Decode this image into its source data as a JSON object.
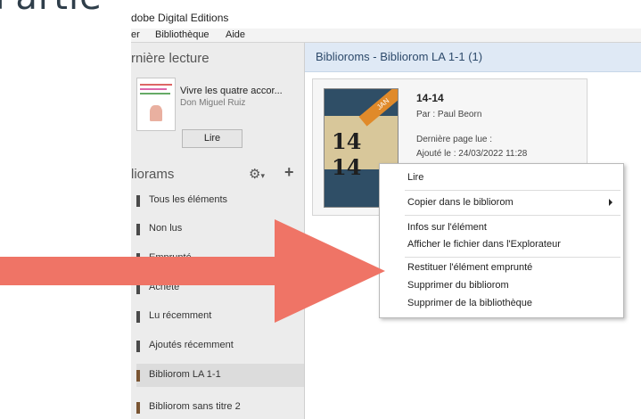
{
  "top_cut_text": "Partie",
  "app": {
    "title": "dobe Digital Editions"
  },
  "menu": {
    "items": [
      "er",
      "Bibliothèque",
      "Aide"
    ]
  },
  "recent": {
    "heading": "rnière lecture",
    "book_title": "Vivre les quatre accor...",
    "book_author": "Don Miguel Ruiz",
    "read_label": "Lire"
  },
  "bookshelves": {
    "heading": "liorams",
    "items": [
      {
        "label": "Tous les éléments"
      },
      {
        "label": "Non lus"
      },
      {
        "label": "Emprunté"
      },
      {
        "label": "Acheté"
      },
      {
        "label": "Lu récemment"
      },
      {
        "label": "Ajoutés récemment"
      },
      {
        "label": "Bibliorom LA 1-1",
        "selected": true
      },
      {
        "label": "Bibliorom sans titre 2"
      }
    ]
  },
  "main": {
    "header": "Biblioroms - Bibliorom LA 1-1 (1)",
    "book": {
      "cover_number": "14 14",
      "cover_badge": "JAN",
      "title": "14-14",
      "author": "Par : Paul Beorn",
      "last_page": "Dernière page lue :",
      "added": "Ajouté le : 24/03/2022 11:28"
    }
  },
  "context_menu": {
    "items": [
      {
        "label": "Lire"
      },
      {
        "label": "Copier dans le bibliorom",
        "submenu": true
      },
      {
        "label": "Infos sur l'élément"
      },
      {
        "label": "Afficher le fichier dans l'Explorateur"
      },
      {
        "label": "Restituer l'élément emprunté"
      },
      {
        "label": "Supprimer du bibliorom"
      },
      {
        "label": "Supprimer de la bibliothèque"
      }
    ]
  },
  "colors": {
    "arrow": "#ef7466",
    "header_bg": "#dfe9f5",
    "sidebar_bg": "#ececec"
  }
}
